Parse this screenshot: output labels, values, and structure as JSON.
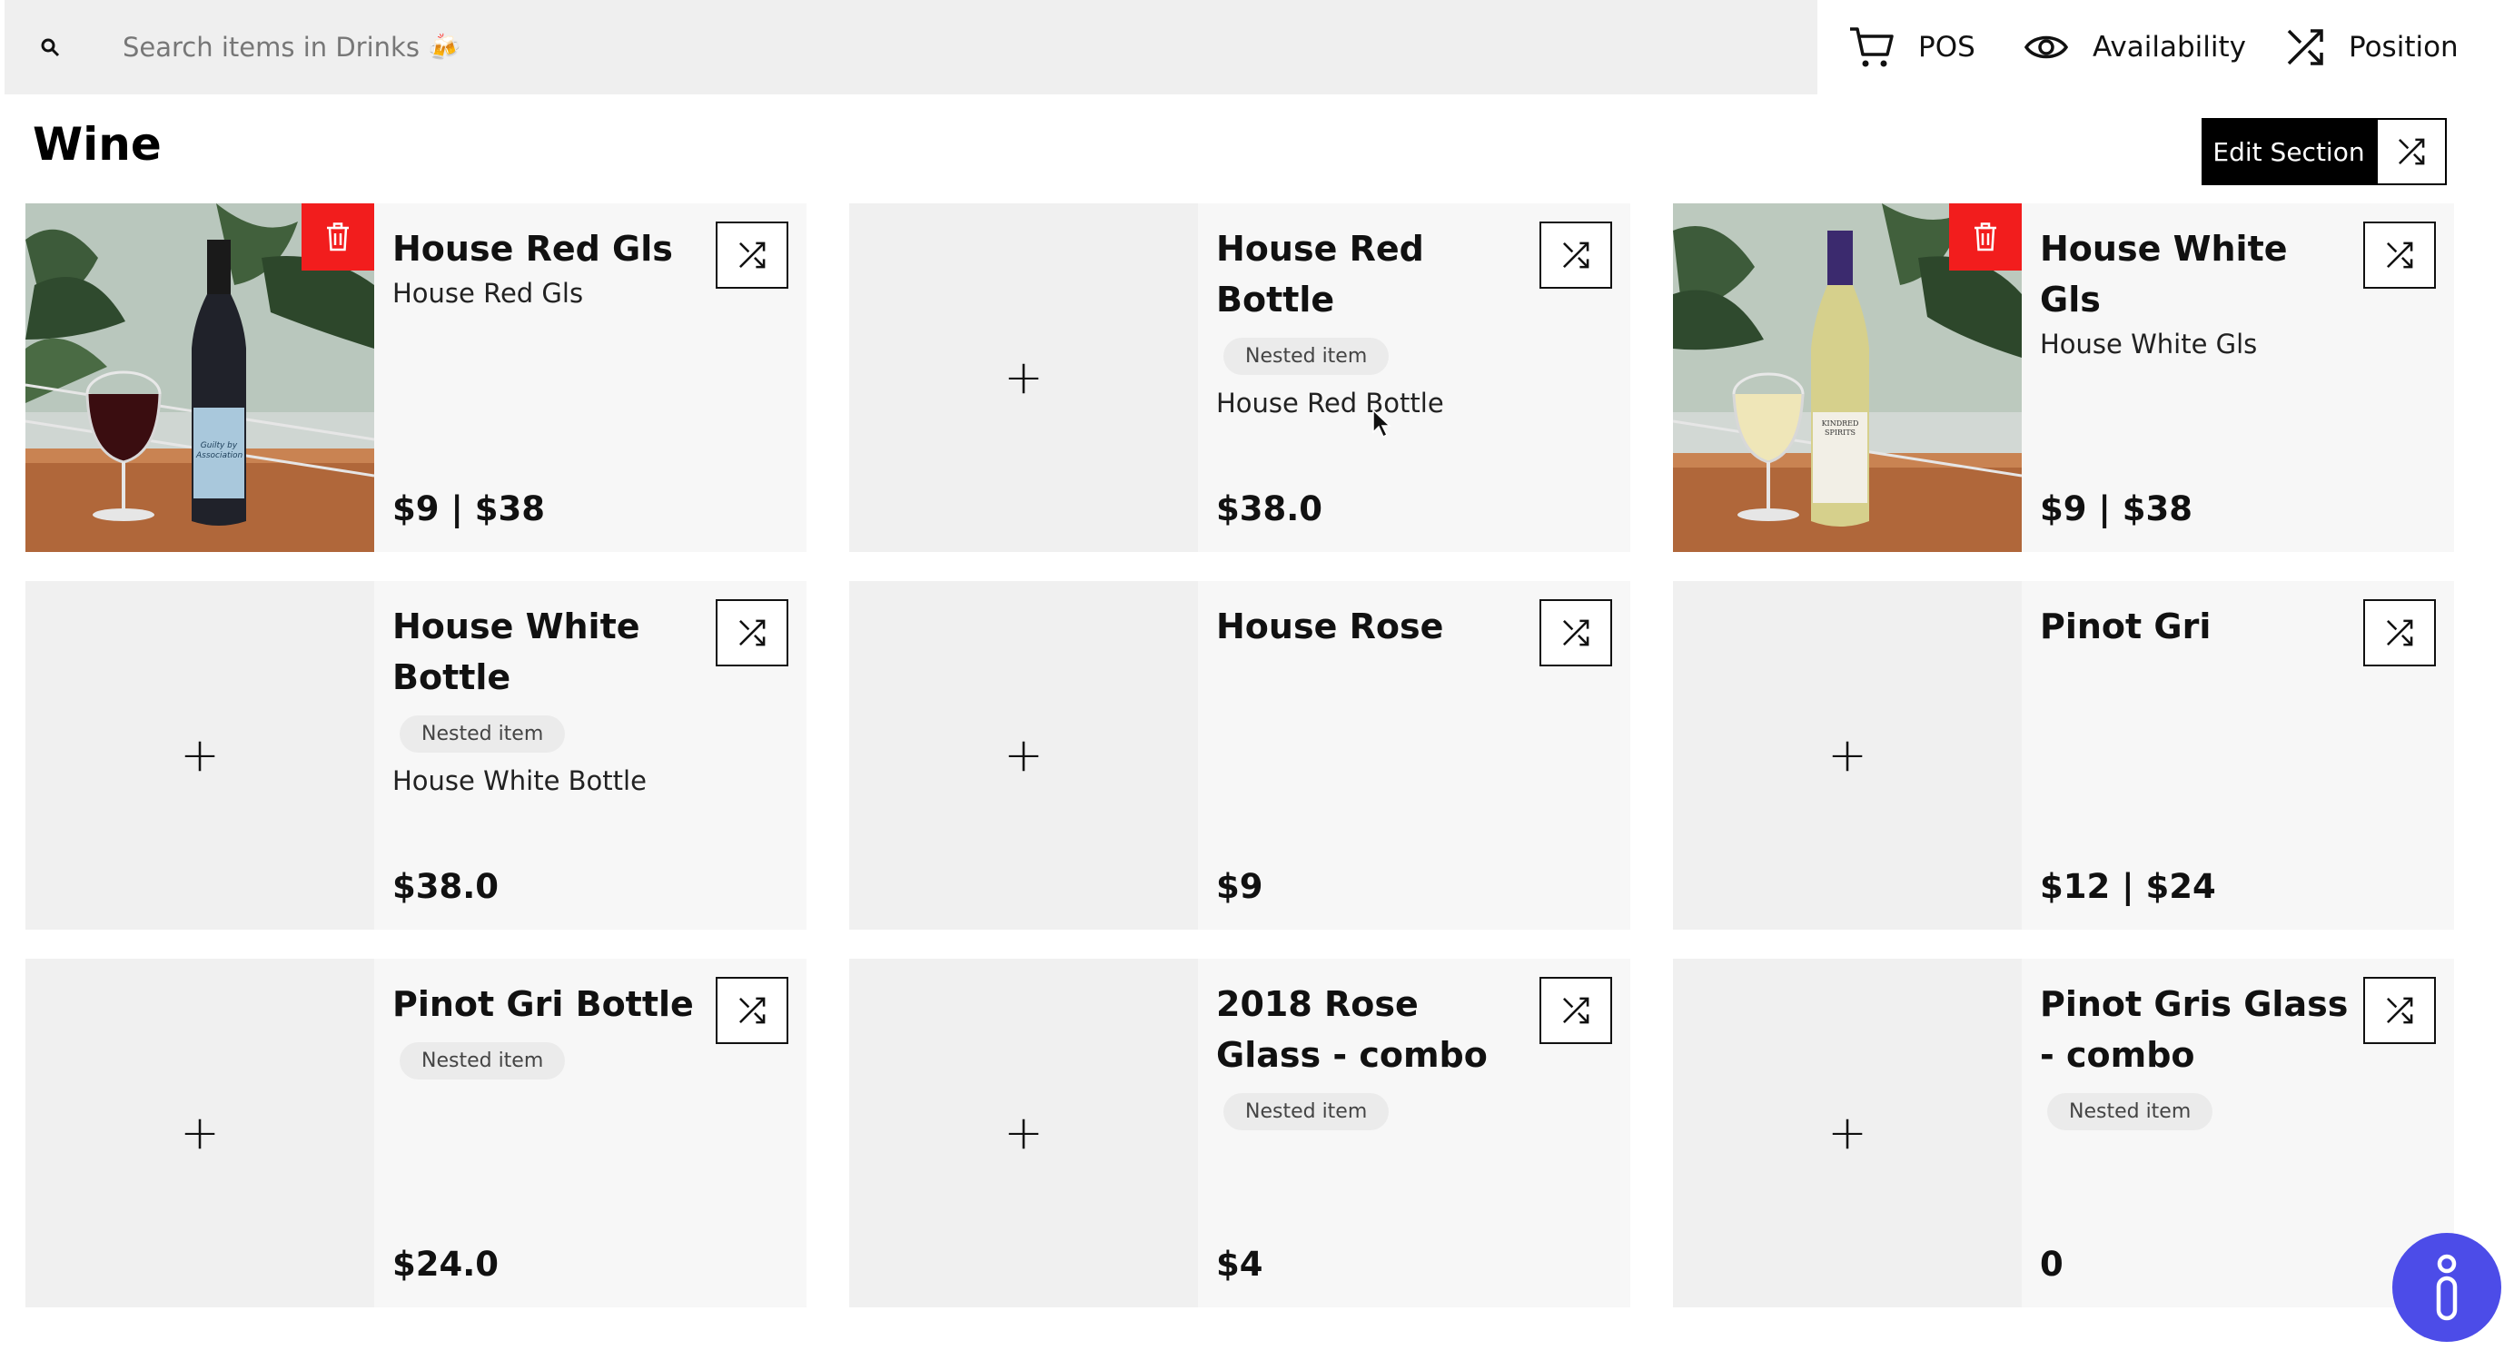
{
  "search": {
    "placeholder": "Search items in Drinks 🍻",
    "value": ""
  },
  "toolbar": {
    "pos": "POS",
    "availability": "Availability",
    "position": "Position"
  },
  "section": {
    "title": "Wine",
    "edit_label": "Edit Section"
  },
  "items": [
    {
      "name": "House Red Gls",
      "badge": "",
      "subtitle": "House Red Gls",
      "price": "$9 | $38",
      "has_image": true
    },
    {
      "name": "House Red Bottle",
      "badge": "Nested item",
      "subtitle": "House Red Bottle",
      "price": "$38.0",
      "has_image": false
    },
    {
      "name": "House White Gls",
      "badge": "",
      "subtitle": "House White Gls",
      "price": "$9 | $38",
      "has_image": true
    },
    {
      "name": "House White Bottle",
      "badge": "Nested item",
      "subtitle": "House White Bottle",
      "price": "$38.0",
      "has_image": false
    },
    {
      "name": "House Rose",
      "badge": "",
      "subtitle": "",
      "price": "$9",
      "has_image": false
    },
    {
      "name": "Pinot Gri",
      "badge": "",
      "subtitle": "",
      "price": "$12 | $24",
      "has_image": false
    },
    {
      "name": "Pinot Gri Bottle",
      "badge": "Nested item",
      "subtitle": "",
      "price": "$24.0",
      "has_image": false
    },
    {
      "name": "2018 Rose Glass - combo",
      "badge": "Nested item",
      "subtitle": "",
      "price": "$4",
      "has_image": false
    },
    {
      "name": "Pinot Gris Glass - combo",
      "badge": "Nested item",
      "subtitle": "",
      "price": "0",
      "has_image": false
    }
  ],
  "image_labels": {
    "red_wine_label": "Guilty by Association",
    "white_wine_label": "KINDRED SPIRITS"
  },
  "colors": {
    "delete": "#f21d1d",
    "help_button": "#4c4ce8",
    "edit_button": "#000000"
  }
}
